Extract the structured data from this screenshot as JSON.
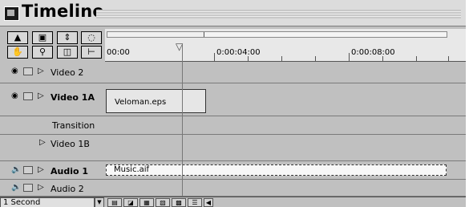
{
  "window": {
    "title": "Timeline"
  },
  "ruler": {
    "times": [
      "00:00",
      "0:00:04:00",
      "0:00:08:00"
    ]
  },
  "tracks": [
    {
      "label": "Video 2",
      "bold": false
    },
    {
      "label": "Video 1A",
      "bold": true
    },
    {
      "label": "Transition",
      "bold": false
    },
    {
      "label": "Video 1B",
      "bold": false
    },
    {
      "label": "Audio 1",
      "bold": true
    },
    {
      "label": "Audio 2",
      "bold": false
    }
  ],
  "clips": {
    "video": "Veloman.eps",
    "audio": "Music.aif"
  },
  "status": {
    "zoom": "1 Second"
  },
  "icons": [
    "selection-tool-icon",
    "range-select-icon",
    "track-select-icon",
    "razor-icon",
    "hand-icon",
    "zoom-icon",
    "slip-tool-icon",
    "in-out-tool-icon",
    "eye-icon",
    "speaker-icon",
    "expand-triangle-icon"
  ]
}
